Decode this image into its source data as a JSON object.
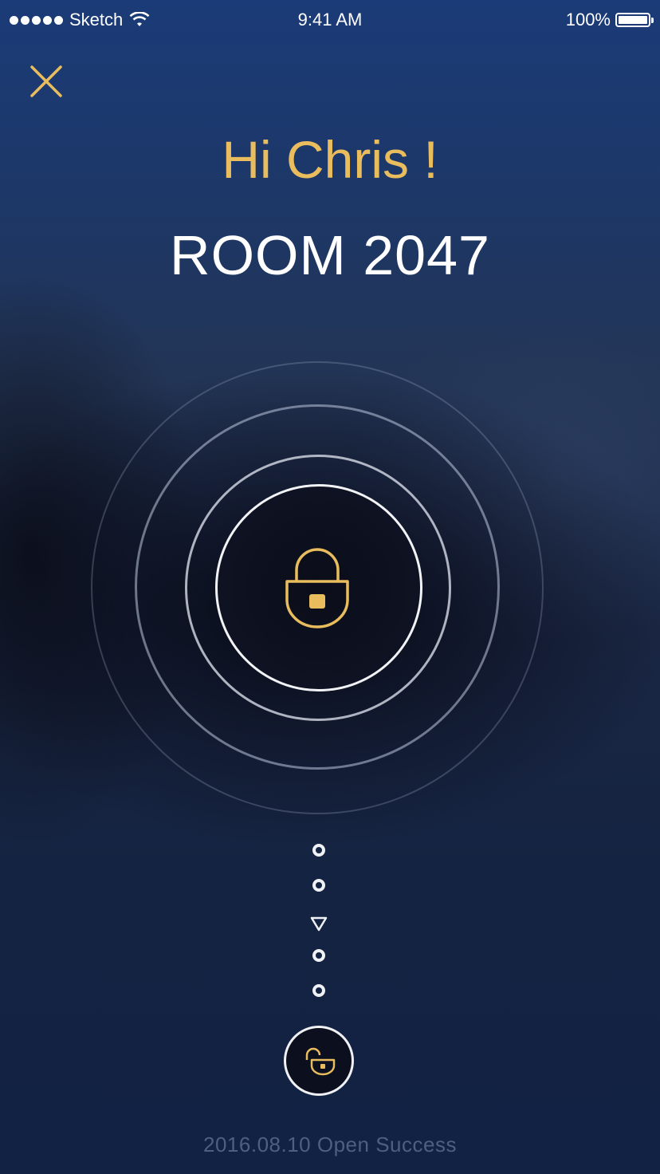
{
  "status_bar": {
    "carrier": "Sketch",
    "time": "9:41 AM",
    "battery_percent": "100%"
  },
  "header": {
    "close_icon": "close-icon",
    "greeting": "Hi Chris !",
    "room": "ROOM 2047"
  },
  "lock": {
    "icon": "padlock-icon",
    "accent_color": "#e9bd5e"
  },
  "swipe_indicator": {
    "items": [
      "dot",
      "dot",
      "arrow-down",
      "dot",
      "dot"
    ]
  },
  "unlock_button": {
    "icon": "open-padlock-icon"
  },
  "footer": {
    "status_text": "2016.08.10 Open Success"
  }
}
